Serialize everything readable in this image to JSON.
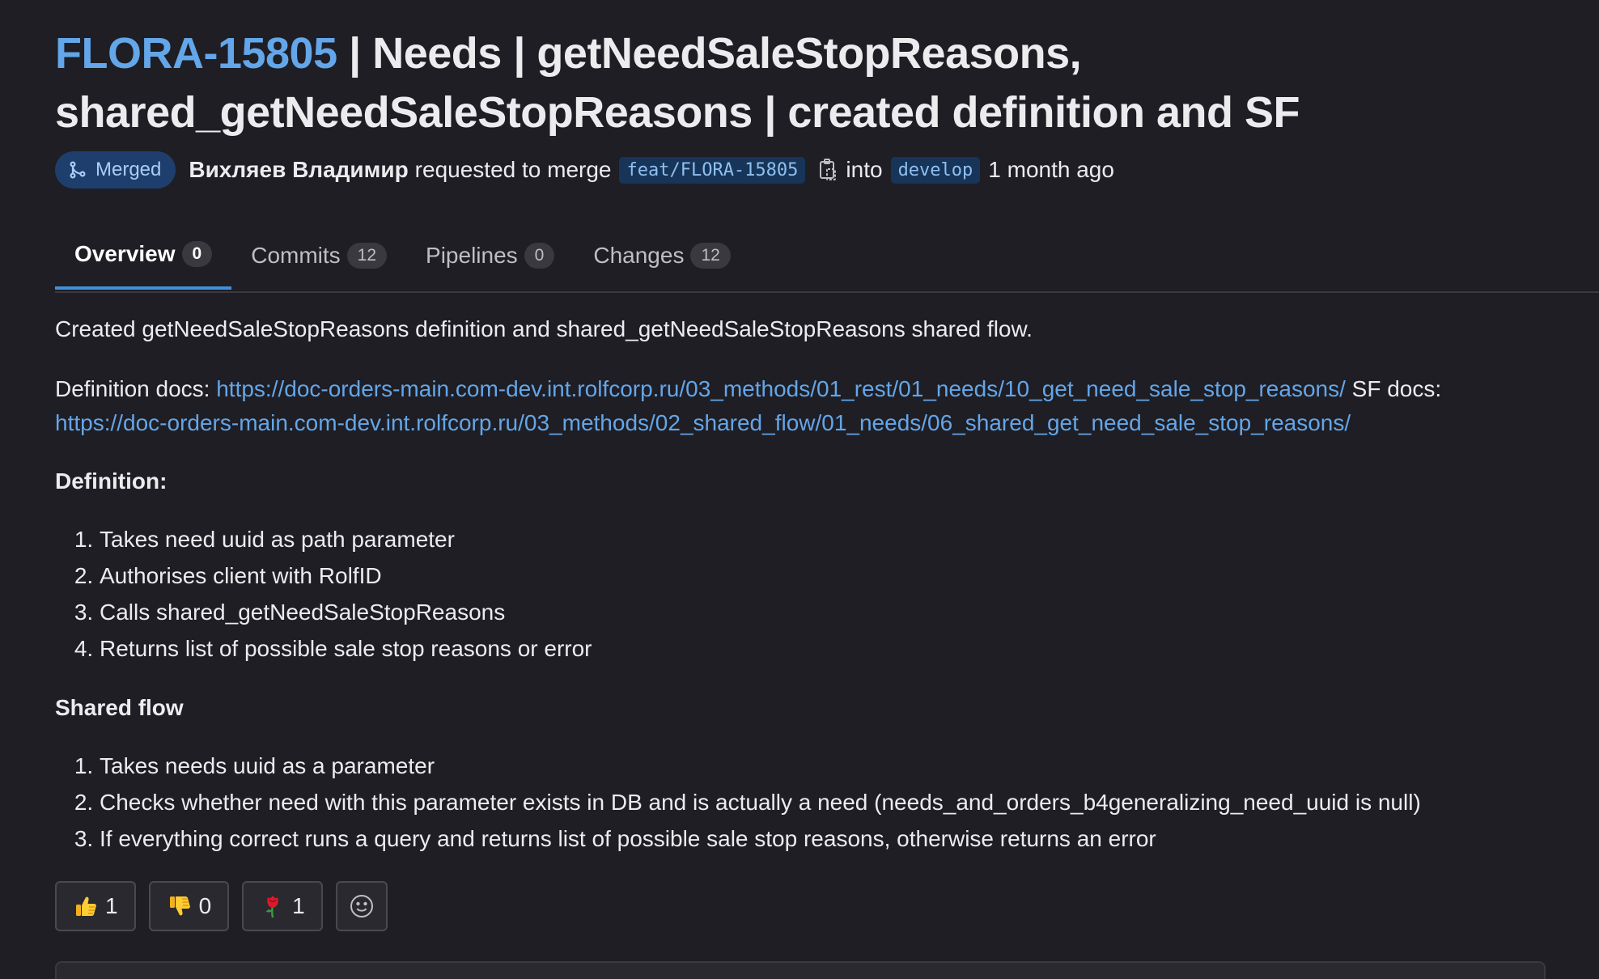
{
  "mr": {
    "key": "FLORA-15805",
    "title_rest": " | Needs | getNeedSaleStopReasons, shared_getNeedSaleStopReasons | created definition and SF",
    "status": "Merged",
    "author": "Вихляев Владимир",
    "requested_text": "requested to merge",
    "source_branch": "feat/FLORA-15805",
    "into_text": "into",
    "target_branch": "develop",
    "time_ago": "1 month ago"
  },
  "tabs": [
    {
      "label": "Overview",
      "count": "0",
      "active": true
    },
    {
      "label": "Commits",
      "count": "12",
      "active": false
    },
    {
      "label": "Pipelines",
      "count": "0",
      "active": false
    },
    {
      "label": "Changes",
      "count": "12",
      "active": false
    }
  ],
  "description": {
    "intro": "Created getNeedSaleStopReasons definition and shared_getNeedSaleStopReasons shared flow.",
    "docs_label": "Definition docs: ",
    "docs_link": "https://doc-orders-main.com-dev.int.rolfcorp.ru/03_methods/01_rest/01_needs/10_get_need_sale_stop_reasons/",
    "sf_docs_label": " SF docs: ",
    "sf_docs_link": "https://doc-orders-main.com-dev.int.rolfcorp.ru/03_methods/02_shared_flow/01_needs/06_shared_get_need_sale_stop_reasons/",
    "definition_heading": "Definition:",
    "definition_items": [
      "Takes need uuid as path parameter",
      "Authorises client with RolfID",
      "Calls shared_getNeedSaleStopReasons",
      "Returns list of possible sale stop reasons or error"
    ],
    "shared_heading": "Shared flow",
    "shared_items": [
      "Takes needs uuid as a parameter",
      "Checks whether need with this parameter exists in DB and is actually a need (needs_and_orders_b4generalizing_need_uuid is null)",
      "If everything correct runs a query and returns list of possible sale stop reasons, otherwise returns an error"
    ]
  },
  "reactions": [
    {
      "icon": "thumbs-up-icon",
      "count": "1"
    },
    {
      "icon": "thumbs-down-icon",
      "count": "0"
    },
    {
      "icon": "rose-icon",
      "count": "1"
    }
  ],
  "colors": {
    "background": "#1f1e24",
    "link": "#63a6e9",
    "merged_badge": "#1e3f6d",
    "branch_bg": "#173459",
    "active_tab_underline": "#428fdc"
  }
}
